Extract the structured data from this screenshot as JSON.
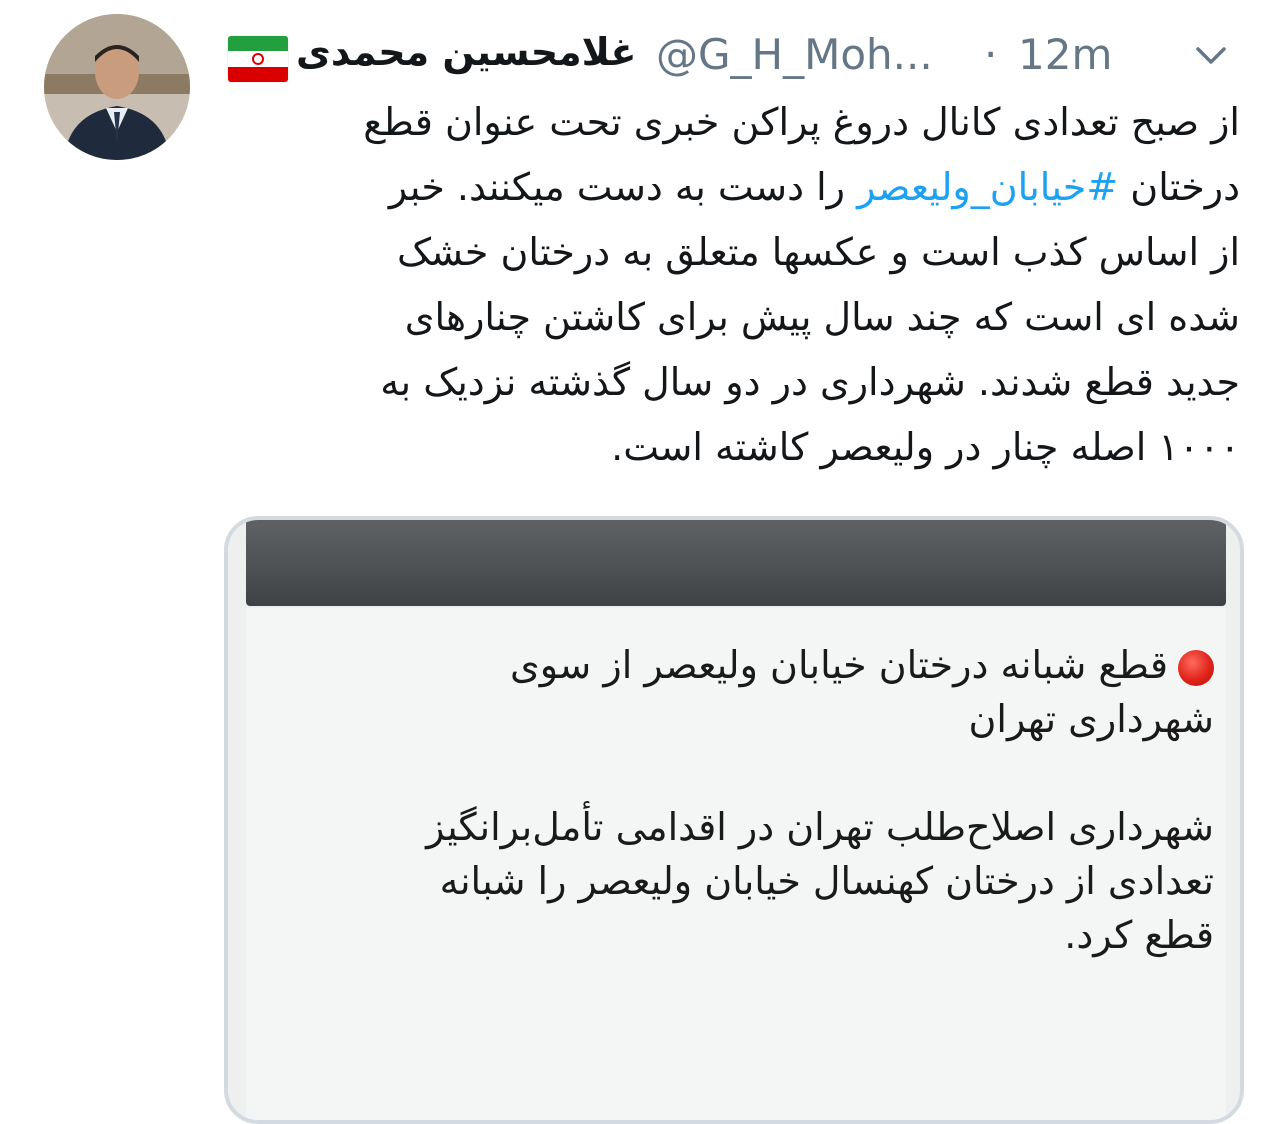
{
  "author": {
    "name": "غلامحسین محمدی",
    "handle": "@G_H_Moh...",
    "separator": "·",
    "time": "12m",
    "flag_icon": "iran-flag-icon",
    "menu_icon": "chevron-down-icon"
  },
  "tweet": {
    "lines": [
      "از صبح تعدادی کانال دروغ پراکن خبری تحت عنوان قطع",
      "را دست به دست میکنند. خبر",
      "از اساس کذب است و عکسها متعلق به درختان خشک",
      "شده ای است که چند سال پیش برای کاشتن چنارهای",
      "جدید قطع شدند. شهرداری در دو سال گذشته نزدیک به",
      "۱۰۰۰ اصله چنار در ولیعصر کاشته است."
    ],
    "line2_prefix": "درختان",
    "hashtag": "#خیابان_ولیعصر"
  },
  "media": {
    "lines": [
      "قطع شبانه درختان خیابان ولیعصر از سوی",
      "شهرداری تهران",
      "شهرداری اصلاح‌طلب تهران در اقدامی تأمل‌برانگیز",
      "تعدادی از درختان کهنسال خیابان ولیعصر را شبانه",
      "قطع کرد."
    ]
  },
  "colors": {
    "hashtag": "#1da1f2",
    "meta": "#657786",
    "border": "#d3dbe0"
  }
}
